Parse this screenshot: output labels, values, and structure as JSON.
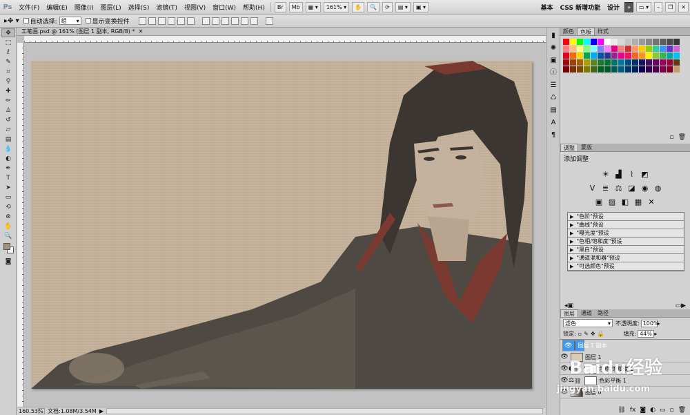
{
  "app": {
    "logo": "Ps"
  },
  "menu": [
    "文件(F)",
    "编辑(E)",
    "图像(I)",
    "图层(L)",
    "选择(S)",
    "滤镜(T)",
    "视图(V)",
    "窗口(W)",
    "帮助(H)"
  ],
  "menubar": {
    "zoom": "161%",
    "workspace_basic": "基本",
    "workspace_css": "CSS 新增功能",
    "workspace_design": "设计",
    "more": "»"
  },
  "options": {
    "auto_select_label": "自动选择:",
    "auto_select_value": "组",
    "transform_label": "显示变换控件"
  },
  "document": {
    "tab_title": "工笔画.psd @ 161% (图层 1 副本, RGB/8) *"
  },
  "status": {
    "zoom": "160.53%",
    "doc_info": "文档:1.08M/3.54M"
  },
  "colors": {
    "foreground": "#a39078",
    "background": "#ffffff",
    "selected_layer": "#3c98f0",
    "canvas": "#c4b19a"
  },
  "panels": {
    "color_tabs": [
      "颜色",
      "色板",
      "样式"
    ],
    "adjust_tabs": [
      "调整",
      "蒙版"
    ],
    "adjust_title": "添加调整",
    "presets": [
      "\"色阶\"预设",
      "\"曲线\"预设",
      "\"曝光度\"预设",
      "\"色相/饱和度\"预设",
      "\"黑白\"预设",
      "\"通道混和器\"预设",
      "\"可选颜色\"预设"
    ],
    "layer_tabs": [
      "图层",
      "通道",
      "路径"
    ],
    "blend_mode": "滤色",
    "opacity_label": "不透明度:",
    "opacity": "100%",
    "lock_label": "锁定:",
    "fill_label": "填充:",
    "fill": "44%",
    "layers": [
      {
        "name": "图层 1 副本",
        "selected": true
      },
      {
        "name": "图层 1",
        "selected": false
      },
      {
        "name": "色相/饱和度 1",
        "selected": false
      },
      {
        "name": "色彩平衡 1",
        "selected": false
      },
      {
        "name": "图层 0",
        "selected": false
      }
    ]
  },
  "watermark": {
    "brand": "Baidu经验",
    "url": "jingyan.baidu.com"
  }
}
